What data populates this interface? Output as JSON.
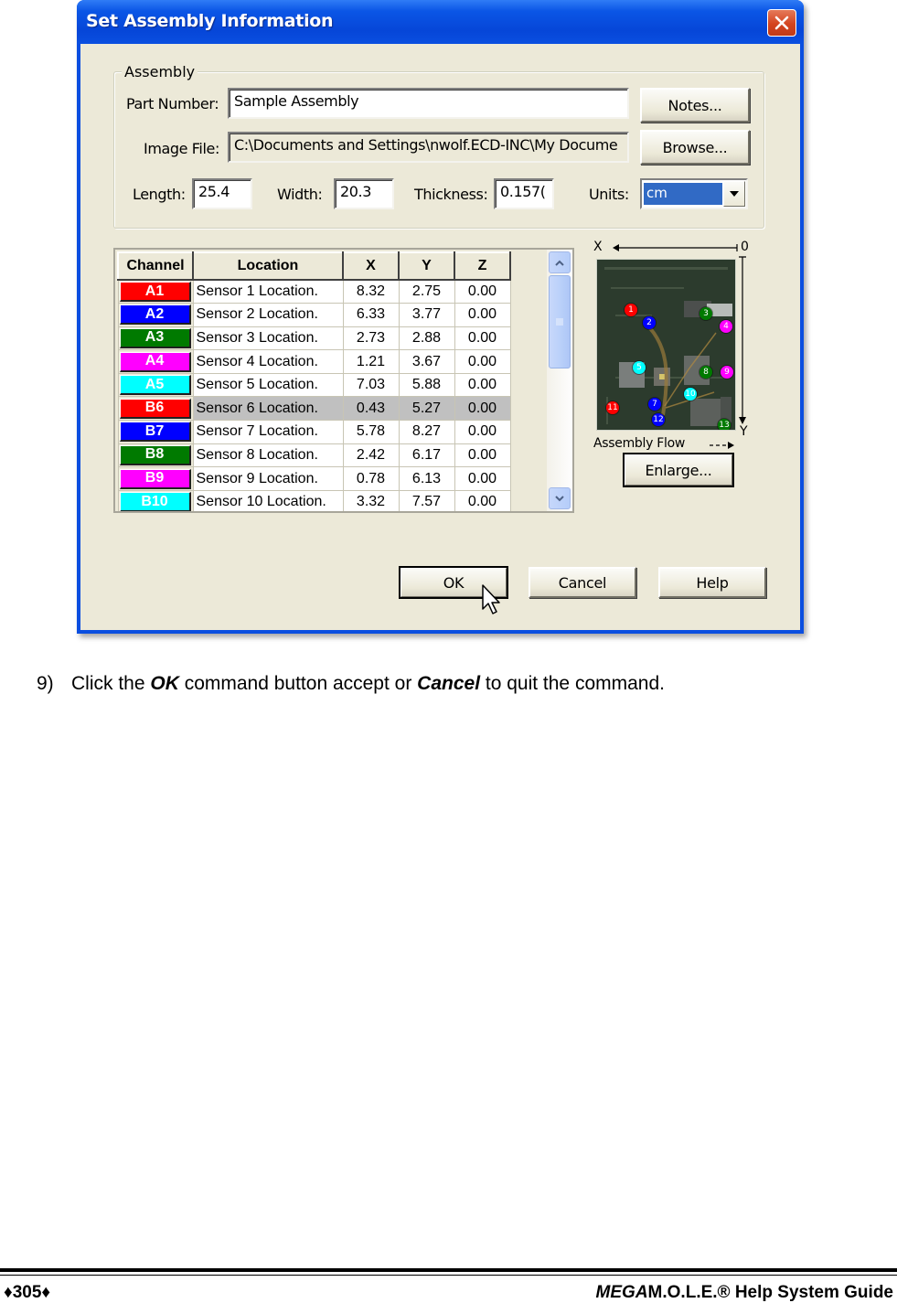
{
  "dialog": {
    "title": "Set Assembly Information",
    "close_icon": "close-x-icon",
    "assembly_group": {
      "legend": "Assembly",
      "part_number_label": "Part Number:",
      "part_number_value": "Sample Assembly",
      "image_file_label": "Image File:",
      "image_file_value": "C:\\Documents and Settings\\nwolf.ECD-INC\\My Docume",
      "length_label": "Length:",
      "length_value": "25.4",
      "width_label": "Width:",
      "width_value": "20.3",
      "thickness_label": "Thickness:",
      "thickness_value": "0.157(",
      "units_label": "Units:",
      "units_value": "cm",
      "notes_button": "Notes...",
      "browse_button": "Browse..."
    },
    "grid": {
      "columns": [
        "Channel",
        "Location",
        "X",
        "Y",
        "Z"
      ],
      "rows": [
        {
          "channel": "A1",
          "color": "#ff0000",
          "location": "Sensor 1 Location.",
          "x": "8.32",
          "y": "2.75",
          "z": "0.00",
          "selected": false
        },
        {
          "channel": "A2",
          "color": "#0000ff",
          "location": "Sensor 2 Location.",
          "x": "6.33",
          "y": "3.77",
          "z": "0.00",
          "selected": false
        },
        {
          "channel": "A3",
          "color": "#007a00",
          "location": "Sensor 3 Location.",
          "x": "2.73",
          "y": "2.88",
          "z": "0.00",
          "selected": false
        },
        {
          "channel": "A4",
          "color": "#ff00ff",
          "location": "Sensor 4 Location.",
          "x": "1.21",
          "y": "3.67",
          "z": "0.00",
          "selected": false
        },
        {
          "channel": "A5",
          "color": "#00ffff",
          "location": "Sensor 5 Location.",
          "x": "7.03",
          "y": "5.88",
          "z": "0.00",
          "selected": false
        },
        {
          "channel": "B6",
          "color": "#ff0000",
          "location": "Sensor 6 Location.",
          "x": "0.43",
          "y": "5.27",
          "z": "0.00",
          "selected": true
        },
        {
          "channel": "B7",
          "color": "#0000ff",
          "location": "Sensor 7 Location.",
          "x": "5.78",
          "y": "8.27",
          "z": "0.00",
          "selected": false
        },
        {
          "channel": "B8",
          "color": "#007a00",
          "location": "Sensor 8 Location.",
          "x": "2.42",
          "y": "6.17",
          "z": "0.00",
          "selected": false
        },
        {
          "channel": "B9",
          "color": "#ff00ff",
          "location": "Sensor 9 Location.",
          "x": "0.78",
          "y": "6.13",
          "z": "0.00",
          "selected": false
        },
        {
          "channel": "B10",
          "color": "#00ffff",
          "location": "Sensor 10 Location.",
          "x": "3.32",
          "y": "7.57",
          "z": "0.00",
          "selected": false
        }
      ]
    },
    "image_panel": {
      "x_axis_label": "X",
      "origin_label": "0",
      "y_axis_label": "Y",
      "flow_label": "Assembly Flow",
      "enlarge_button": "Enlarge...",
      "pins": [
        {
          "n": "1",
          "color": "#ff0000"
        },
        {
          "n": "2",
          "color": "#0000ff"
        },
        {
          "n": "3",
          "color": "#007a00"
        },
        {
          "n": "4",
          "color": "#ff00ff"
        },
        {
          "n": "5",
          "color": "#00ffff"
        },
        {
          "n": "8",
          "color": "#007a00"
        },
        {
          "n": "9",
          "color": "#ff00ff"
        },
        {
          "n": "10",
          "color": "#00ffff"
        },
        {
          "n": "7",
          "color": "#0000ff"
        },
        {
          "n": "11",
          "color": "#ff0000"
        },
        {
          "n": "12",
          "color": "#0000ff"
        },
        {
          "n": "13",
          "color": "#007a00"
        }
      ]
    },
    "buttons": {
      "ok": "OK",
      "cancel": "Cancel",
      "help": "Help"
    }
  },
  "instruction": {
    "number": "9)",
    "pre": "Click the ",
    "ok_word": "OK",
    "mid": " command button accept or ",
    "cancel_word": "Cancel",
    "post": " to quit the command."
  },
  "footer": {
    "page_number": "♦305♦",
    "guide_italic": "MEGA",
    "guide_rest": "M.O.L.E.® Help System Guide"
  }
}
